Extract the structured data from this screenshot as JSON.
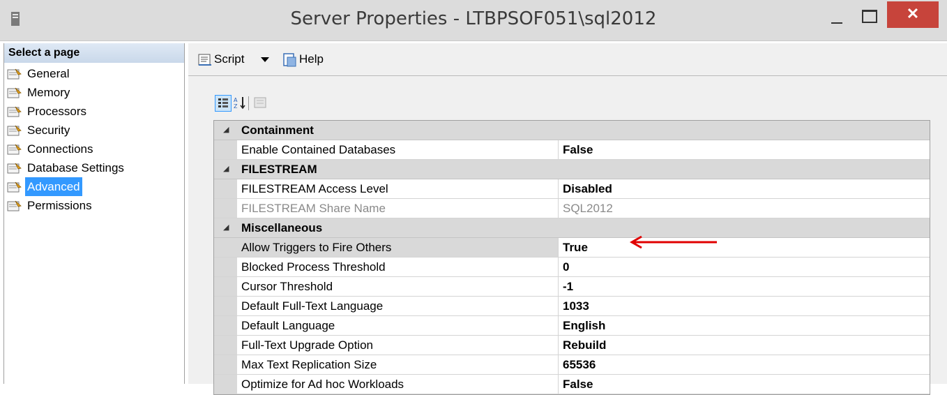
{
  "window": {
    "title": "Server Properties - LTBPSOF051\\sql2012",
    "close_glyph": "✕"
  },
  "sidebar": {
    "header": "Select a page",
    "items": [
      {
        "label": "General"
      },
      {
        "label": "Memory"
      },
      {
        "label": "Processors"
      },
      {
        "label": "Security"
      },
      {
        "label": "Connections"
      },
      {
        "label": "Database Settings"
      },
      {
        "label": "Advanced",
        "selected": true
      },
      {
        "label": "Permissions"
      }
    ]
  },
  "toolbar": {
    "script_label": "Script",
    "help_label": "Help"
  },
  "grid": {
    "categories": [
      {
        "name": "Containment",
        "rows": [
          {
            "name": "Enable Contained Databases",
            "value": "False"
          }
        ]
      },
      {
        "name": "FILESTREAM",
        "rows": [
          {
            "name": "FILESTREAM Access Level",
            "value": "Disabled"
          },
          {
            "name": "FILESTREAM Share Name",
            "value": "SQL2012",
            "disabled": true
          }
        ]
      },
      {
        "name": "Miscellaneous",
        "rows": [
          {
            "name": "Allow Triggers to Fire Others",
            "value": "True",
            "selected": true
          },
          {
            "name": "Blocked Process Threshold",
            "value": "0"
          },
          {
            "name": "Cursor Threshold",
            "value": "-1"
          },
          {
            "name": "Default Full-Text Language",
            "value": "1033"
          },
          {
            "name": "Default Language",
            "value": "English"
          },
          {
            "name": "Full-Text Upgrade Option",
            "value": "Rebuild"
          },
          {
            "name": "Max Text Replication Size",
            "value": "65536"
          },
          {
            "name": "Optimize for Ad hoc Workloads",
            "value": "False"
          }
        ]
      }
    ]
  },
  "annotation_color": "#e00000",
  "selection_color": "#3399ff"
}
